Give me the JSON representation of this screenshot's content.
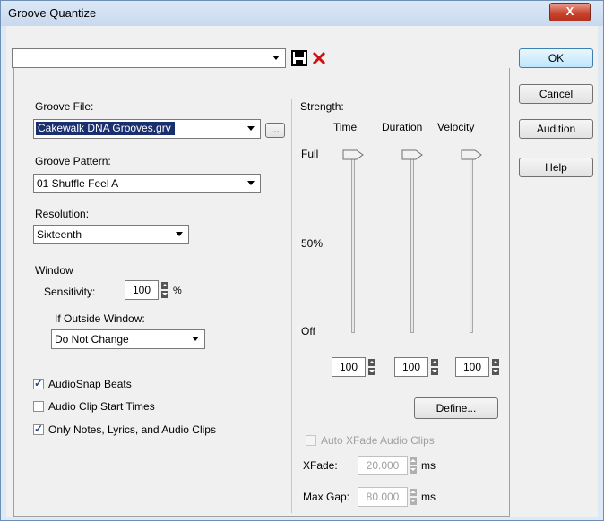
{
  "window": {
    "title": "Groove Quantize",
    "close_label": "X"
  },
  "preset": {
    "value": ""
  },
  "buttons": {
    "ok": "OK",
    "cancel": "Cancel",
    "audition": "Audition",
    "help": "Help",
    "define": "Define...",
    "browse": "..."
  },
  "groove_file": {
    "label": "Groove File:",
    "value": "Cakewalk DNA Grooves.grv"
  },
  "groove_pattern": {
    "label": "Groove Pattern:",
    "value": "01 Shuffle Feel A"
  },
  "resolution": {
    "label": "Resolution:",
    "value": "Sixteenth"
  },
  "window_group": {
    "label": "Window",
    "sensitivity_label": "Sensitivity:",
    "sensitivity_value": "100",
    "sensitivity_unit": "%",
    "outside_label": "If Outside Window:",
    "outside_value": "Do Not Change"
  },
  "checkboxes": [
    {
      "label": "AudioSnap Beats",
      "checked": true
    },
    {
      "label": "Audio Clip Start Times",
      "checked": false
    },
    {
      "label": "Only Notes, Lyrics, and Audio Clips",
      "checked": true
    }
  ],
  "strength": {
    "label": "Strength:",
    "scale": [
      "Full",
      "50%",
      "Off"
    ],
    "sliders": [
      {
        "label": "Time",
        "value": "100"
      },
      {
        "label": "Duration",
        "value": "100"
      },
      {
        "label": "Velocity",
        "value": "100"
      }
    ]
  },
  "xfade": {
    "auto_label": "Auto XFade Audio Clips",
    "auto_checked": false,
    "xfade_label": "XFade:",
    "xfade_value": "20.000",
    "xfade_unit": "ms",
    "gap_label": "Max Gap:",
    "gap_value": "80.000",
    "gap_unit": "ms"
  },
  "colors": {
    "selection": "#1a2f6e",
    "title_bar": "#c8d9ee",
    "close_button": "#c9452f"
  }
}
